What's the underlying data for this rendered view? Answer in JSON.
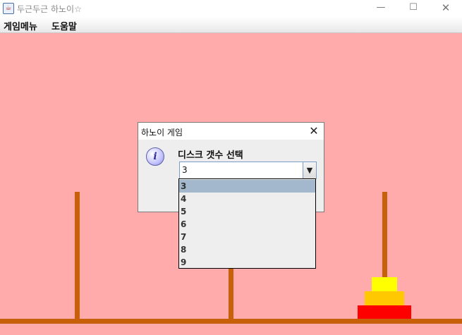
{
  "window": {
    "title": "두근두근 하노이☆",
    "app_icon": "java-cup-icon",
    "controls": {
      "minimize": "—",
      "maximize": "☐",
      "close": "✕"
    }
  },
  "menubar": {
    "items": [
      "게임메뉴",
      "도움말"
    ]
  },
  "game": {
    "colors": {
      "background": "#ffabab",
      "peg": "#c8600a",
      "disk_small": "#ffff00",
      "disk_medium": "#ffc800",
      "disk_large": "#ff0000"
    },
    "disks_on_peg_c": 3
  },
  "dialog": {
    "title": "하노이 게임",
    "close_symbol": "✕",
    "icon": "info-icon",
    "icon_glyph": "i",
    "prompt": "디스크 갯수 선택",
    "combo": {
      "selected": "3",
      "arrow": "▼",
      "options": [
        "3",
        "4",
        "5",
        "6",
        "7",
        "8",
        "9"
      ],
      "highlighted": "3"
    }
  }
}
